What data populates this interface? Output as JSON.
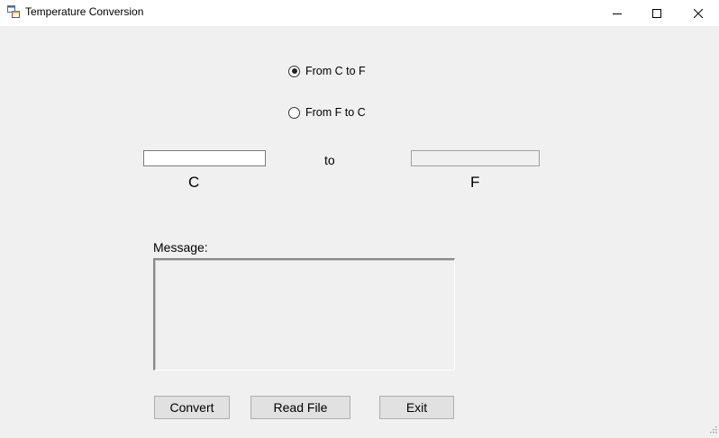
{
  "window": {
    "title": "Temperature Conversion",
    "icon": "windows-form-icon",
    "controls": [
      "minimize-icon",
      "maximize-icon",
      "close-icon"
    ]
  },
  "conversion": {
    "options": [
      {
        "label": "From C to F",
        "selected": true
      },
      {
        "label": "From F to C",
        "selected": false
      }
    ],
    "input_value": "",
    "output_value": "",
    "to_label": "to",
    "input_unit": "C",
    "output_unit": "F"
  },
  "message": {
    "label": "Message:",
    "text": ""
  },
  "buttons": {
    "convert": "Convert",
    "read_file": "Read File",
    "exit": "Exit"
  }
}
